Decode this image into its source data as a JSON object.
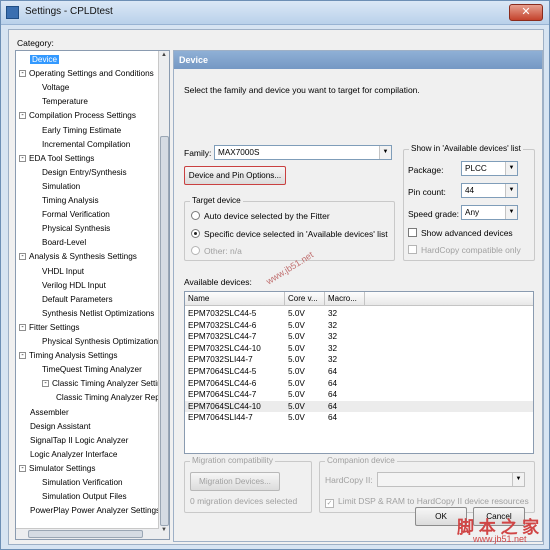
{
  "window": {
    "title": "Settings - CPLDtest",
    "close_label": "✕"
  },
  "category_label": "Category:",
  "tree": [
    {
      "label": "Device",
      "level": 0,
      "toggle": "",
      "selected": true
    },
    {
      "label": "Operating Settings and Conditions",
      "level": 0,
      "toggle": "-"
    },
    {
      "label": "Voltage",
      "level": 1,
      "toggle": ""
    },
    {
      "label": "Temperature",
      "level": 1,
      "toggle": ""
    },
    {
      "label": "Compilation Process Settings",
      "level": 0,
      "toggle": "-"
    },
    {
      "label": "Early Timing Estimate",
      "level": 1,
      "toggle": ""
    },
    {
      "label": "Incremental Compilation",
      "level": 1,
      "toggle": ""
    },
    {
      "label": "EDA Tool Settings",
      "level": 0,
      "toggle": "-"
    },
    {
      "label": "Design Entry/Synthesis",
      "level": 1,
      "toggle": ""
    },
    {
      "label": "Simulation",
      "level": 1,
      "toggle": ""
    },
    {
      "label": "Timing Analysis",
      "level": 1,
      "toggle": ""
    },
    {
      "label": "Formal Verification",
      "level": 1,
      "toggle": ""
    },
    {
      "label": "Physical Synthesis",
      "level": 1,
      "toggle": ""
    },
    {
      "label": "Board-Level",
      "level": 1,
      "toggle": ""
    },
    {
      "label": "Analysis & Synthesis Settings",
      "level": 0,
      "toggle": "-"
    },
    {
      "label": "VHDL Input",
      "level": 1,
      "toggle": ""
    },
    {
      "label": "Verilog HDL Input",
      "level": 1,
      "toggle": ""
    },
    {
      "label": "Default Parameters",
      "level": 1,
      "toggle": ""
    },
    {
      "label": "Synthesis Netlist Optimizations",
      "level": 1,
      "toggle": ""
    },
    {
      "label": "Fitter Settings",
      "level": 0,
      "toggle": "-"
    },
    {
      "label": "Physical Synthesis Optimizations",
      "level": 1,
      "toggle": ""
    },
    {
      "label": "Timing Analysis Settings",
      "level": 0,
      "toggle": "-"
    },
    {
      "label": "TimeQuest Timing Analyzer",
      "level": 1,
      "toggle": ""
    },
    {
      "label": "Classic Timing Analyzer Settings",
      "level": 1,
      "toggle": "-"
    },
    {
      "label": "Classic Timing Analyzer Reports",
      "level": 2,
      "toggle": ""
    },
    {
      "label": "Assembler",
      "level": 0,
      "toggle": ""
    },
    {
      "label": "Design Assistant",
      "level": 0,
      "toggle": ""
    },
    {
      "label": "SignalTap II Logic Analyzer",
      "level": 0,
      "toggle": ""
    },
    {
      "label": "Logic Analyzer Interface",
      "level": 0,
      "toggle": ""
    },
    {
      "label": "Simulator Settings",
      "level": 0,
      "toggle": "-"
    },
    {
      "label": "Simulation Verification",
      "level": 1,
      "toggle": ""
    },
    {
      "label": "Simulation Output Files",
      "level": 1,
      "toggle": ""
    },
    {
      "label": "PowerPlay Power Analyzer Settings",
      "level": 0,
      "toggle": ""
    }
  ],
  "panel": {
    "title": "Device",
    "intro": "Select the family and device you want to target for compilation.",
    "family_label": "Family:",
    "family_value": "MAX7000S",
    "device_pin_button": "Device and Pin Options...",
    "target_device": {
      "title": "Target device",
      "auto": "Auto device selected by the Fitter",
      "specific": "Specific device selected in 'Available devices' list",
      "other": "Other:  n/a"
    },
    "show_in_list": {
      "title": "Show in 'Available devices' list",
      "package_label": "Package:",
      "package_value": "PLCC",
      "pin_count_label": "Pin count:",
      "pin_count_value": "44",
      "speed_label": "Speed grade:",
      "speed_value": "Any",
      "advanced": "Show advanced devices",
      "hardcopy": "HardCopy compatible only"
    },
    "available_label": "Available devices:",
    "columns": [
      "Name",
      "Core v...",
      "Macro..."
    ],
    "devices": [
      [
        "EPM7032SLC44-5",
        "5.0V",
        "32"
      ],
      [
        "EPM7032SLC44-6",
        "5.0V",
        "32"
      ],
      [
        "EPM7032SLC44-7",
        "5.0V",
        "32"
      ],
      [
        "EPM7032SLC44-10",
        "5.0V",
        "32"
      ],
      [
        "EPM7032SLI44-7",
        "5.0V",
        "32"
      ],
      [
        "EPM7064SLC44-5",
        "5.0V",
        "64"
      ],
      [
        "EPM7064SLC44-6",
        "5.0V",
        "64"
      ],
      [
        "EPM7064SLC44-7",
        "5.0V",
        "64"
      ],
      [
        "EPM7064SLC44-10",
        "5.0V",
        "64"
      ],
      [
        "EPM7064SLI44-7",
        "5.0V",
        "64"
      ]
    ],
    "migration": {
      "title": "Migration compatibility",
      "button": "Migration Devices...",
      "selected": "0 migration devices selected"
    },
    "companion": {
      "title": "Companion device",
      "hardcopy_label": "HardCopy II:",
      "limit": "Limit DSP & RAM to HardCopy II device resources"
    }
  },
  "footer": {
    "ok": "OK",
    "cancel": "Cancel"
  },
  "watermark": {
    "site": "www.jb51.net",
    "cn": "脚 本 之 家",
    "url": "www.jb51.net"
  }
}
